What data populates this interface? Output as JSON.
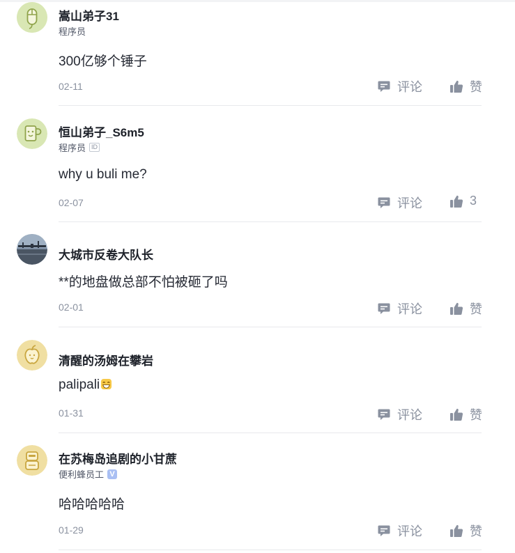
{
  "colors": {
    "text": "#252933",
    "muted": "#8a919f",
    "divider": "#e8e9ec",
    "action_icon": "#8a919f"
  },
  "comments": [
    {
      "username": "嵩山弟子31",
      "subtitle": "程序员",
      "content": "300亿够个锤子",
      "date": "02-11",
      "comment_label": "评论",
      "like_label": "赞",
      "avatar_icon": "mouse-avatar-icon"
    },
    {
      "username": "恒山弟子_S6m5",
      "subtitle": "程序员",
      "id_badge": "ID",
      "content": "why u buli me?",
      "date": "02-07",
      "comment_label": "评论",
      "like_label": "3",
      "avatar_icon": "cup-avatar-icon"
    },
    {
      "username": "大城市反卷大队长",
      "content": "**的地盘做总部不怕被砸了吗",
      "date": "02-01",
      "comment_label": "评论",
      "like_label": "赞",
      "avatar_icon": "photo-avatar"
    },
    {
      "username": "清醒的汤姆在攀岩",
      "content": "palipali",
      "content_emoji": "laugh-emoji-icon",
      "date": "01-31",
      "comment_label": "评论",
      "like_label": "赞",
      "avatar_icon": "apple-avatar-icon"
    },
    {
      "username": "在苏梅岛追剧的小甘蔗",
      "subtitle": "便利蜂员工",
      "verify_badge": "V",
      "content": "哈哈哈哈哈",
      "date": "01-29",
      "comment_label": "评论",
      "like_label": "赞",
      "avatar_icon": "robot-avatar-icon"
    }
  ]
}
